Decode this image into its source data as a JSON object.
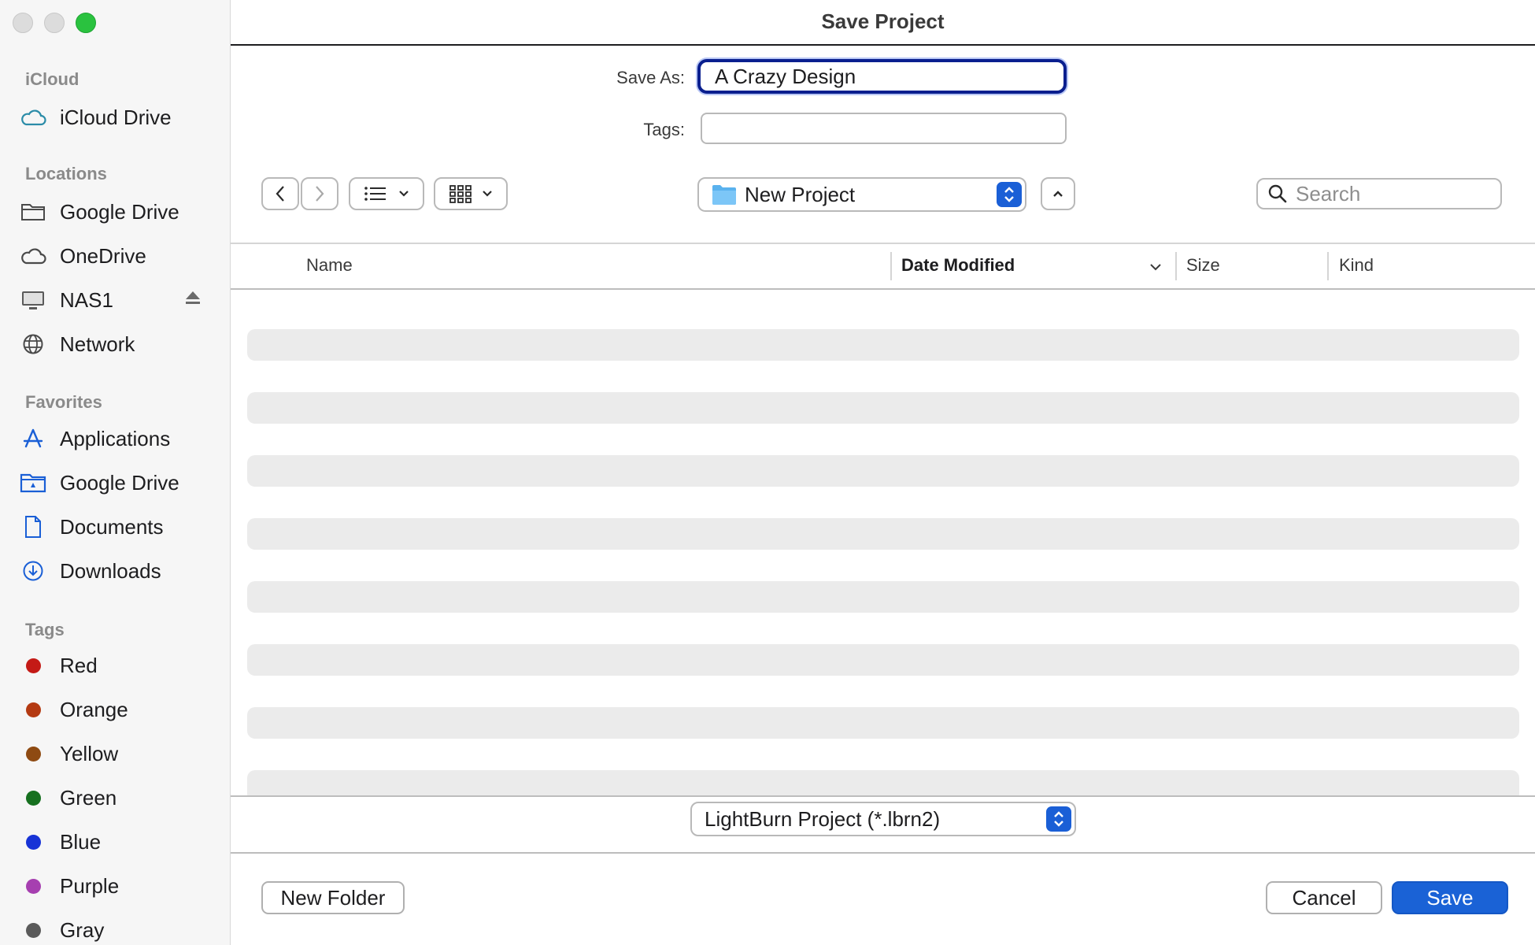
{
  "window": {
    "title": "Save Project"
  },
  "sidebar": {
    "sections": [
      {
        "heading": "iCloud",
        "items": [
          {
            "label": "iCloud Drive",
            "icon": "icloud-icon"
          }
        ]
      },
      {
        "heading": "Locations",
        "items": [
          {
            "label": "Google Drive",
            "icon": "folder-icon"
          },
          {
            "label": "OneDrive",
            "icon": "cloud-icon"
          },
          {
            "label": "NAS1",
            "icon": "display-icon"
          },
          {
            "label": "Network",
            "icon": "globe-icon"
          }
        ]
      },
      {
        "heading": "Favorites",
        "items": [
          {
            "label": "Applications",
            "icon": "applications-icon"
          },
          {
            "label": "Google Drive",
            "icon": "drive-folder-icon"
          },
          {
            "label": "Documents",
            "icon": "document-icon"
          },
          {
            "label": "Downloads",
            "icon": "download-icon"
          }
        ]
      },
      {
        "heading": "Tags",
        "items": [
          {
            "label": "Red",
            "color": "#c41a16"
          },
          {
            "label": "Orange",
            "color": "#b43a12"
          },
          {
            "label": "Yellow",
            "color": "#8e4a12"
          },
          {
            "label": "Green",
            "color": "#16701f"
          },
          {
            "label": "Blue",
            "color": "#1733d6"
          },
          {
            "label": "Purple",
            "color": "#a63fb0"
          },
          {
            "label": "Gray",
            "color": "#5a5a5a"
          }
        ]
      }
    ]
  },
  "form": {
    "save_as_label": "Save As:",
    "save_as_value": "A Crazy Design",
    "tags_label": "Tags:",
    "tags_value": ""
  },
  "toolbar": {
    "current_folder": "New Project",
    "search_placeholder": "Search"
  },
  "columns": {
    "name": "Name",
    "date_modified": "Date Modified",
    "size": "Size",
    "kind": "Kind"
  },
  "file_format": {
    "selected": "LightBurn Project (*.lbrn2)"
  },
  "buttons": {
    "new_folder": "New Folder",
    "cancel": "Cancel",
    "save": "Save"
  },
  "colors": {
    "accent": "#1a62d6",
    "focus_ring": "#0a1f8f"
  }
}
